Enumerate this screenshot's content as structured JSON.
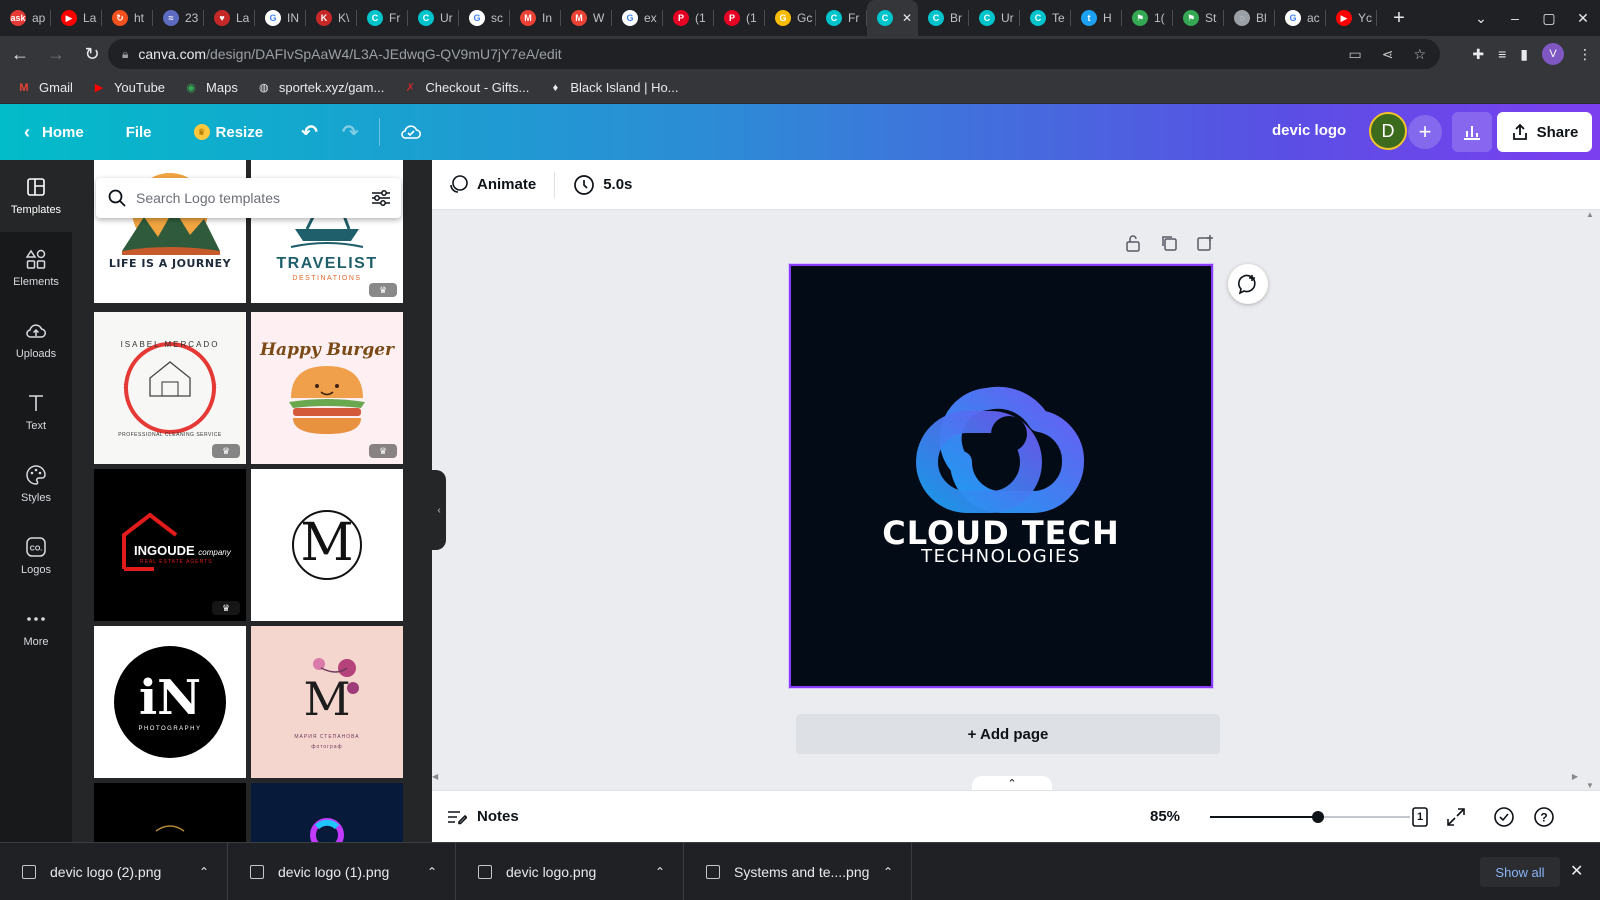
{
  "browser": {
    "tabs": [
      {
        "label": "ap",
        "icon": "ask-icon",
        "color": "#e53935",
        "glyph": "ask"
      },
      {
        "label": "La",
        "icon": "youtube-icon",
        "color": "#ff0000",
        "glyph": "▶"
      },
      {
        "label": "ht",
        "icon": "rotate-icon",
        "color": "#f4511e",
        "glyph": "↻"
      },
      {
        "label": "23",
        "icon": "feather-icon",
        "color": "#5c6bc0",
        "glyph": "≈"
      },
      {
        "label": "La",
        "icon": "heart-icon",
        "color": "#c62828",
        "glyph": "♥"
      },
      {
        "label": "IN",
        "icon": "google-icon",
        "color": "#ffffff",
        "glyph": "G"
      },
      {
        "label": "K\\",
        "icon": "kv-icon",
        "color": "#c62828",
        "glyph": "K"
      },
      {
        "label": "Fr",
        "icon": "canva-icon",
        "color": "#00c4cc",
        "glyph": "C"
      },
      {
        "label": "Ur",
        "icon": "canva-icon",
        "color": "#00c4cc",
        "glyph": "C"
      },
      {
        "label": "sc",
        "icon": "google-icon",
        "color": "#ffffff",
        "glyph": "G"
      },
      {
        "label": "In",
        "icon": "gmail-icon",
        "color": "#ea4335",
        "glyph": "M"
      },
      {
        "label": "W",
        "icon": "gmail-icon",
        "color": "#ea4335",
        "glyph": "M"
      },
      {
        "label": "ex",
        "icon": "google-icon",
        "color": "#ffffff",
        "glyph": "G"
      },
      {
        "label": "(1",
        "icon": "pinterest-icon",
        "color": "#e60023",
        "glyph": "P"
      },
      {
        "label": "(1",
        "icon": "pinterest-icon",
        "color": "#e60023",
        "glyph": "P"
      },
      {
        "label": "Gc",
        "icon": "gdrive-icon",
        "color": "#fbbc04",
        "glyph": "G"
      },
      {
        "label": "Fr",
        "icon": "canva-icon",
        "color": "#00c4cc",
        "glyph": "C"
      },
      {
        "label": "",
        "icon": "canva-icon",
        "color": "#00c4cc",
        "glyph": "C",
        "active": true
      },
      {
        "label": "Br",
        "icon": "canva-icon",
        "color": "#00c4cc",
        "glyph": "C"
      },
      {
        "label": "Ur",
        "icon": "canva-icon",
        "color": "#00c4cc",
        "glyph": "C"
      },
      {
        "label": "Te",
        "icon": "canva-icon",
        "color": "#00c4cc",
        "glyph": "C"
      },
      {
        "label": "H",
        "icon": "twitter-icon",
        "color": "#1da1f2",
        "glyph": "t"
      },
      {
        "label": "1(",
        "icon": "flag-icon",
        "color": "#34a853",
        "glyph": "⚑"
      },
      {
        "label": "St",
        "icon": "flag-icon",
        "color": "#34a853",
        "glyph": "⚑"
      },
      {
        "label": "Bl",
        "icon": "loading-icon",
        "color": "#9aa0a6",
        "glyph": "◌"
      },
      {
        "label": "ac",
        "icon": "google-icon",
        "color": "#ffffff",
        "glyph": "G"
      },
      {
        "label": "Yc",
        "icon": "youtube-icon",
        "color": "#ff0000",
        "glyph": "▶"
      }
    ],
    "url_host": "canva.com",
    "url_path": "/design/DAFIvSpAaW4/L3A-JEdwqG-QV9mU7jY7eA/edit",
    "profile_initial": "V",
    "bookmarks": [
      {
        "label": "Gmail",
        "icon": "gmail-icon",
        "glyph": "M",
        "color": "#ea4335"
      },
      {
        "label": "YouTube",
        "icon": "youtube-icon",
        "glyph": "▶",
        "color": "#ff0000"
      },
      {
        "label": "Maps",
        "icon": "maps-icon",
        "glyph": "◉",
        "color": "#34a853"
      },
      {
        "label": "sportek.xyz/gam...",
        "icon": "globe-icon",
        "glyph": "◍",
        "color": "#e8eaed"
      },
      {
        "label": "Checkout - Gifts...",
        "icon": "checkout-icon",
        "glyph": "✗",
        "color": "#c62828"
      },
      {
        "label": "Black Island | Ho...",
        "icon": "black-island-icon",
        "glyph": "♦",
        "color": "#e8eaed"
      }
    ]
  },
  "canva": {
    "home_label": "Home",
    "file_label": "File",
    "resize_label": "Resize",
    "design_title": "devic logo",
    "avatar_initial": "D",
    "share_label": "Share",
    "rail": [
      {
        "label": "Templates",
        "icon": "templates-icon",
        "active": true
      },
      {
        "label": "Elements",
        "icon": "elements-icon"
      },
      {
        "label": "Uploads",
        "icon": "uploads-icon"
      },
      {
        "label": "Text",
        "icon": "text-icon"
      },
      {
        "label": "Styles",
        "icon": "styles-icon"
      },
      {
        "label": "Logos",
        "icon": "logos-icon"
      },
      {
        "label": "More",
        "icon": "more-icon"
      }
    ],
    "search_placeholder": "Search Logo templates",
    "templates": [
      {
        "name": "life-is-a-journey",
        "text": "LIFE IS A JOURNEY",
        "pro": false
      },
      {
        "name": "travelist",
        "text": "TRAVELIST",
        "sub": "DESTINATIONS",
        "pro": true
      },
      {
        "name": "isabel-mercado",
        "text": "ISABEL MERCADO",
        "sub": "PROFESSIONAL CLEANING SERVICE",
        "pro": true
      },
      {
        "name": "happy-burger",
        "text": "Happy Burger",
        "pro": true
      },
      {
        "name": "ingoude",
        "text": "INGOUDE",
        "sub": "company",
        "sub2": "REAL ESTATE AGENTS",
        "pro": true
      },
      {
        "name": "m-circle",
        "text": "M",
        "pro": false
      },
      {
        "name": "in-photography",
        "text": "iN",
        "sub": "PHOTOGRAPHY",
        "pro": false
      },
      {
        "name": "m-floral",
        "text": "M",
        "sub": "МАРИЯ СТЕПАНОВА",
        "sub2": "фотограф",
        "pro": false
      }
    ],
    "animate_label": "Animate",
    "duration": "5.0s",
    "logo_title": "CLOUD TECH",
    "logo_subtitle": "TECHNOLOGIES",
    "add_page_label": "+ Add page",
    "notes_label": "Notes",
    "zoom_percent": "85%",
    "zoom_fraction": 0.54,
    "page_count": "1",
    "brand_colors": {
      "page_bg": "#030b17",
      "logo_blue": "#2f8fee",
      "logo_purple": "#5b5ff0",
      "selection": "#8b3dff"
    }
  },
  "downloads": {
    "items": [
      "devic logo (2).png",
      "devic logo (1).png",
      "devic logo.png",
      "Systems and te....png"
    ],
    "show_all_label": "Show all"
  }
}
